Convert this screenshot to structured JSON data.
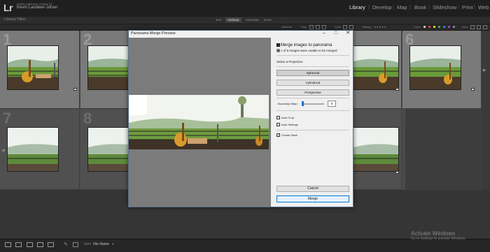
{
  "app": {
    "logo": "Lr",
    "product": "Adobe Lightroom Classic CC",
    "user": "Kevin Landwer-Johan"
  },
  "modules": [
    "Library",
    "Develop",
    "Map",
    "Book",
    "Slideshow",
    "Print",
    "Web"
  ],
  "filter_bar": {
    "title": "Library Filter :",
    "tabs": [
      "Text",
      "Attribute",
      "Metadata",
      "None"
    ],
    "active": "Attribute"
  },
  "options_bar": {
    "attribute": "Attribute",
    "flag": "Flag",
    "edits": "Edits",
    "rating": "Rating",
    "color": "Color",
    "kind": "Kind",
    "swatch_colors": [
      "#c8c8c8",
      "#d9443a",
      "#e0c838",
      "#4fa845",
      "#3c7bd4",
      "#9a4fc0",
      "#888888"
    ]
  },
  "grid": {
    "numbers": [
      "1",
      "2",
      "6",
      "7",
      "8"
    ]
  },
  "dialog": {
    "title": "Panorama Merge Preview",
    "heading": "Merge images to panorama",
    "warning": "1 of 9 images were unable to be merged",
    "projection_label": "Select a Projection",
    "projections": [
      "Spherical",
      "Cylindrical",
      "Perspective"
    ],
    "active_projection": "Spherical",
    "boundary_warp_label": "Boundary Warp:",
    "boundary_warp_value": "0",
    "checkboxes": [
      {
        "label": "Auto Crop",
        "checked": false
      },
      {
        "label": "Auto Settings",
        "checked": false
      },
      {
        "label": "Create Stack",
        "checked": true
      }
    ],
    "cancel": "Cancel",
    "merge": "Merge"
  },
  "toolbar": {
    "sort_label": "Sort:",
    "sort_value": "File Name"
  },
  "watermark": {
    "title": "Activate Windows",
    "subtitle": "Go to Settings to activate Windows."
  }
}
